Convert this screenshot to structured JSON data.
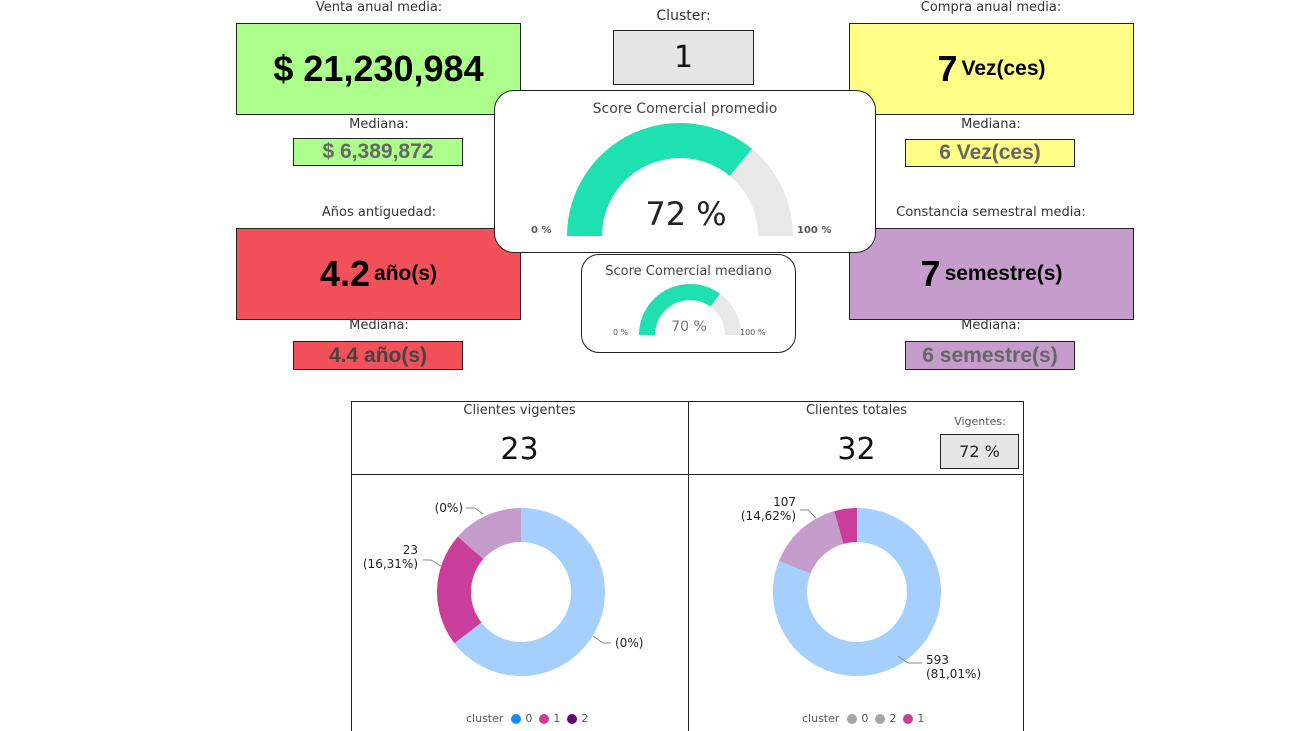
{
  "cards": {
    "venta": {
      "title": "Venta anual media:",
      "value": "$ 21,230,984",
      "median_label": "Mediana:",
      "median_value": "$ 6,389,872",
      "color": "#abff8a"
    },
    "cluster": {
      "title": "Cluster:",
      "value": "1",
      "color": "#e6e6e6"
    },
    "compra": {
      "title": "Compra anual media:",
      "value": "7",
      "unit": "Vez(ces)",
      "median_label": "Mediana:",
      "median_value": "6 Vez(ces)",
      "color": "#ffff88"
    },
    "antiguedad": {
      "title": "Años antiguedad:",
      "value": "4.2",
      "unit": "año(s)",
      "median_label": "Mediana:",
      "median_value": "4.4 año(s)",
      "color": "#f4505a"
    },
    "constancia": {
      "title": "Constancia semestral media:",
      "value": "7",
      "unit": "semestre(s)",
      "median_label": "Mediana:",
      "median_value": "6 semestre(s)",
      "color": "#c59ccc"
    }
  },
  "gauges": {
    "promedio": {
      "title": "Score Comercial promedio",
      "value_label": "72 %",
      "value": 0.72,
      "min_label": "0 %",
      "max_label": "100 %",
      "fill": "#1ee0b0",
      "track": "#e8e8e8"
    },
    "mediano": {
      "title": "Score Comercial mediano",
      "value_label": "70 %",
      "value": 0.7,
      "min_label": "0 %",
      "max_label": "100 %",
      "fill": "#1ee0b0",
      "track": "#e8e8e8"
    }
  },
  "kpis": {
    "vigentes": {
      "title": "Clientes vigentes",
      "value": "23"
    },
    "totales": {
      "title": "Clientes totales",
      "value": "32",
      "badge_label": "Vigentes:",
      "badge_value": "72 %"
    }
  },
  "chart_data": [
    {
      "type": "pie",
      "variant": "donut",
      "slices": [
        {
          "name": "0",
          "value": 0,
          "label": "(0%)",
          "color": "#a5cffc"
        },
        {
          "name": "1",
          "value": 23,
          "label": "23\n(16,31%)",
          "color": "#c93e9a"
        },
        {
          "name": "2",
          "value": 0,
          "label": "(0%)",
          "color": "#c59ccc"
        }
      ],
      "legend": {
        "title": "cluster",
        "entries": [
          "0",
          "1",
          "2"
        ],
        "colors": [
          "#118dff",
          "#c93e9a",
          "#6b007b"
        ],
        "placement": "bottom"
      }
    },
    {
      "type": "pie",
      "variant": "donut",
      "slices": [
        {
          "name": "0",
          "value": 593,
          "label": "593\n(81,01%)",
          "color": "#a5cffc"
        },
        {
          "name": "2",
          "value": 107,
          "label": "107\n(14,62%)",
          "color": "#c59ccc"
        },
        {
          "name": "1",
          "value": 32,
          "label": "",
          "color": "#c93e9a"
        }
      ],
      "legend": {
        "title": "cluster",
        "entries": [
          "0",
          "2",
          "1"
        ],
        "colors": [
          "#a6a6a6",
          "#a6a6a6",
          "#c93e9a"
        ],
        "placement": "bottom"
      }
    }
  ]
}
